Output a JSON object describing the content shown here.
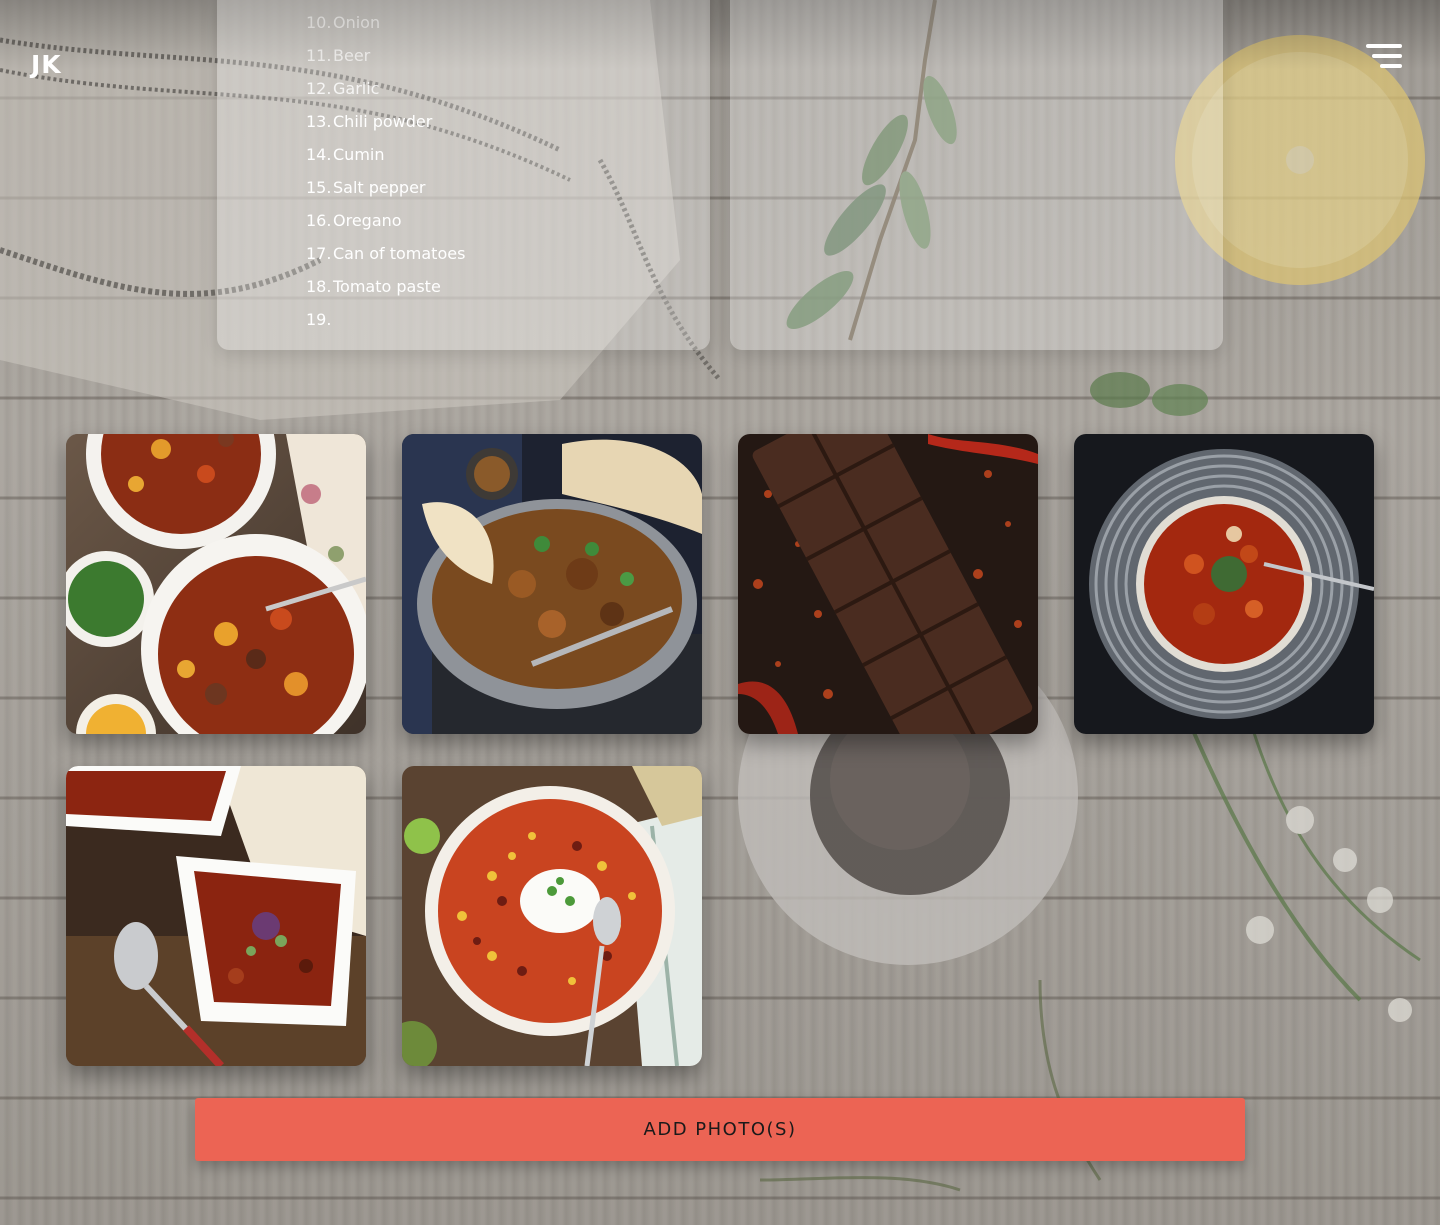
{
  "brand": {
    "logo_text": "JK"
  },
  "header": {
    "menu_icon": "hamburger-menu-icon"
  },
  "ingredients": {
    "items": [
      {
        "number": "10.",
        "name": "Onion"
      },
      {
        "number": "11.",
        "name": "Beer"
      },
      {
        "number": "12.",
        "name": "Garlic"
      },
      {
        "number": "13.",
        "name": "Chili powder"
      },
      {
        "number": "14.",
        "name": "Cumin"
      },
      {
        "number": "15.",
        "name": "Salt pepper"
      },
      {
        "number": "16.",
        "name": "Oregano"
      },
      {
        "number": "17.",
        "name": "Can of tomatoes"
      },
      {
        "number": "18.",
        "name": "Tomato paste"
      },
      {
        "number": "19.",
        "name": ""
      }
    ]
  },
  "gallery": {
    "photos": [
      {
        "icon": "chili-bowls-photo"
      },
      {
        "icon": "curry-pan-naan-photo"
      },
      {
        "icon": "chocolate-bar-chili-flakes-photo"
      },
      {
        "icon": "tomato-soup-plate-photo"
      },
      {
        "icon": "chili-square-bowls-photo"
      },
      {
        "icon": "bean-chili-sour-cream-photo"
      }
    ]
  },
  "actions": {
    "add_photos_label": "ADD PHOTO(S)"
  },
  "colors": {
    "accent": "#ec6454",
    "text_light": "#ffffff"
  }
}
